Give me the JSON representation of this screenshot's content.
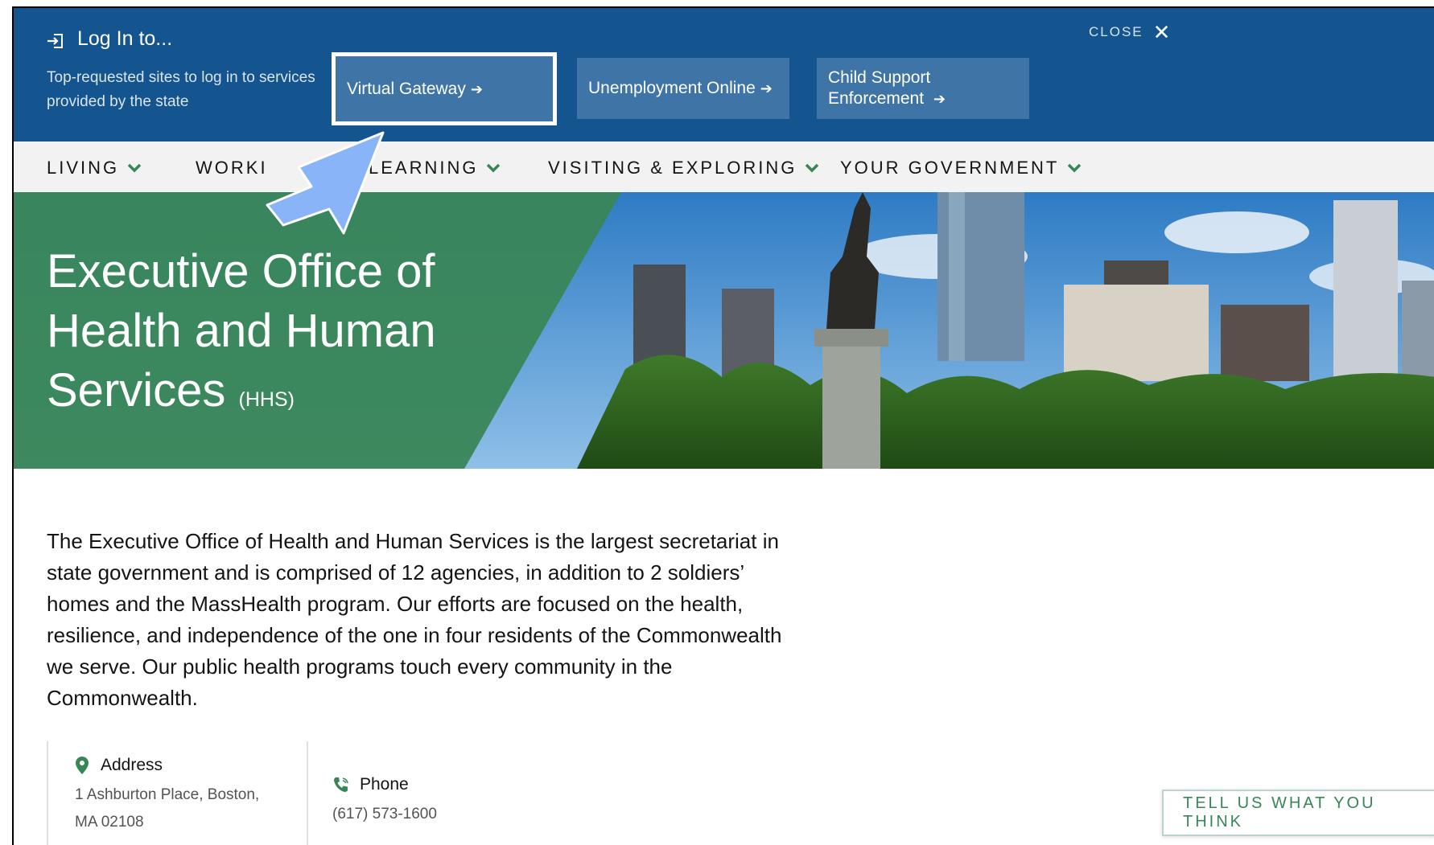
{
  "login": {
    "title": "Log In to...",
    "description": "Top-requested sites to log in to services provided by the state",
    "close_label": "CLOSE",
    "services": [
      {
        "label": "Virtual Gateway"
      },
      {
        "label": "Unemployment Online"
      },
      {
        "label": "Child Support Enforcement"
      }
    ]
  },
  "nav": {
    "items": [
      "LIVING",
      "WORKI",
      "LEARNING",
      "VISITING & EXPLORING",
      "YOUR GOVERNMENT"
    ]
  },
  "hero": {
    "title_line1": "Executive Office of",
    "title_line2": "Health and Human",
    "title_line3": "Services",
    "abbr": "(HHS)"
  },
  "intro": "The Executive Office of Health and Human Services is the largest secretariat in state government and is comprised of 12 agencies, in addition to 2 soldiers’ homes and the MassHealth program. Our efforts are focused on the health, resilience, and independence of the one in four residents of the Commonwealth we serve. Our public health programs touch every community in the Commonwealth.",
  "contact": {
    "address_label": "Address",
    "address_line1": "1 Ashburton Place, Boston,",
    "address_line2": "MA 02108",
    "phone_label": "Phone",
    "phone_value": "(617) 573-1600"
  },
  "feedback_label": "TELL US WHAT YOU THINK",
  "colors": {
    "login_bg": "#14558f",
    "service_bg": "#3f74a7",
    "nav_bg": "#f2f2f2",
    "accent_green": "#388557",
    "pointer_blue": "#8ab4f8"
  }
}
